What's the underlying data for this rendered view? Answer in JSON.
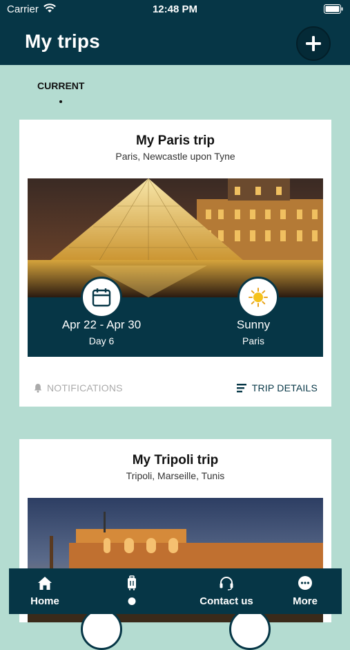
{
  "status_bar": {
    "carrier": "Carrier",
    "time": "12:48 PM"
  },
  "header": {
    "title": "My trips",
    "add_icon": "plus-icon"
  },
  "tabs": {
    "current_label": "CURRENT"
  },
  "trips": [
    {
      "title": "My Paris trip",
      "subtitle": "Paris, Newcastle upon Tyne",
      "dates": "Apr 22 - Apr 30",
      "day": "Day 6",
      "weather": "Sunny",
      "weather_city": "Paris",
      "notifications_label": "NOTIFICATIONS",
      "details_label": "TRIP DETAILS"
    },
    {
      "title": "My Tripoli trip",
      "subtitle": "Tripoli, Marseille, Tunis"
    }
  ],
  "tabbar": {
    "home": "Home",
    "contact": "Contact us",
    "more": "More"
  },
  "colors": {
    "primary": "#063646",
    "background": "#b4dcd1",
    "muted": "#aaaaaa"
  }
}
